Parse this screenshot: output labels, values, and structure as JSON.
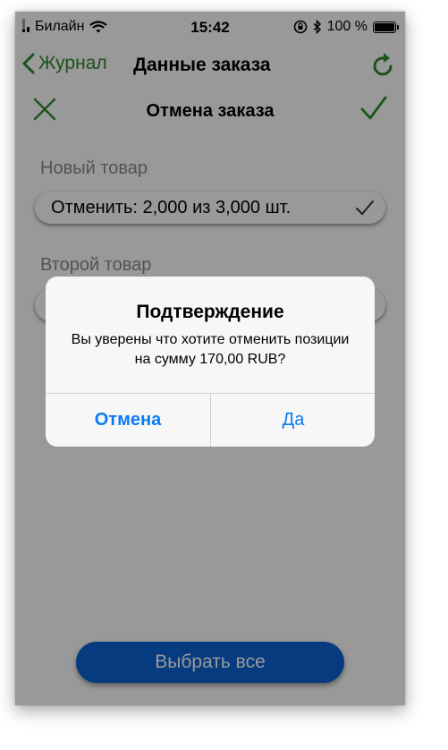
{
  "status_bar": {
    "carrier": "Билайн",
    "time": "15:42",
    "battery": "100 %",
    "icons": [
      "signal-icon",
      "wifi-icon",
      "rotation-lock-icon",
      "bluetooth-icon",
      "battery-icon"
    ]
  },
  "nav": {
    "back_label": "Журнал",
    "title": "Данные заказа",
    "refresh_icon": "refresh-icon"
  },
  "sheet": {
    "title": "Отмена заказа",
    "close_icon": "close-icon",
    "confirm_icon": "checkmark-icon",
    "items": [
      {
        "section_label": "Новый товар",
        "row_text": "Отменить: 2,000 из 3,000 шт."
      },
      {
        "section_label": "Второй товар",
        "row_text": ""
      }
    ],
    "select_all_label": "Выбрать все"
  },
  "alert": {
    "title": "Подтверждение",
    "message": "Вы уверены что хотите отменить позиции на сумму 170,00 RUB?",
    "cancel_label": "Отмена",
    "confirm_label": "Да"
  },
  "colors": {
    "accent_green": "#2e8b2e",
    "button_blue": "#0a63d4",
    "alert_button_text": "#0a7cf2"
  }
}
